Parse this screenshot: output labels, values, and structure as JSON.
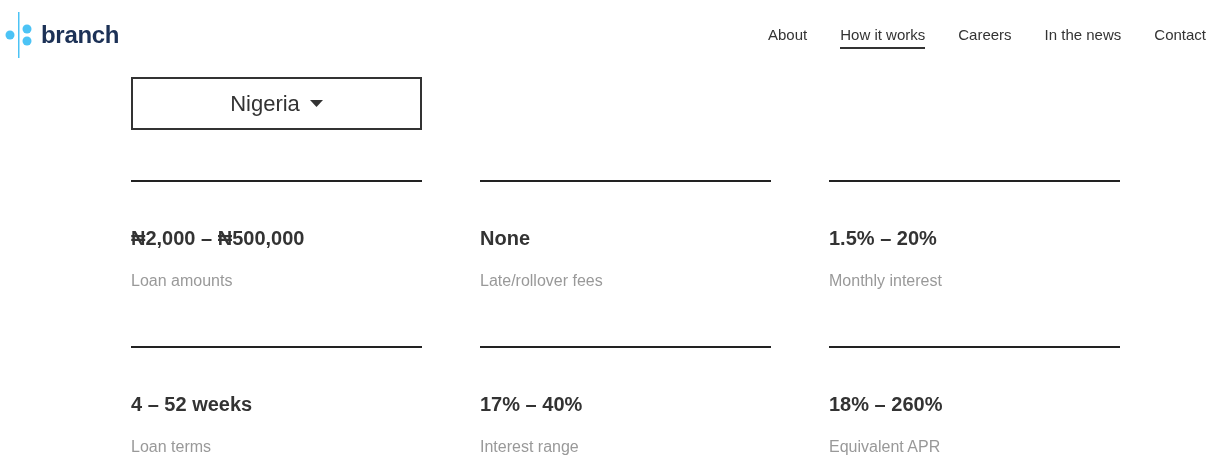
{
  "logo": {
    "text": "branch"
  },
  "nav": [
    {
      "label": "About",
      "selected": false
    },
    {
      "label": "How it works",
      "selected": true
    },
    {
      "label": "Careers",
      "selected": false
    },
    {
      "label": "In the news",
      "selected": false
    },
    {
      "label": "Contact",
      "selected": false
    }
  ],
  "country_select": {
    "value": "Nigeria"
  },
  "stats": [
    {
      "value": "₦2,000 – ₦500,000",
      "label": "Loan amounts"
    },
    {
      "value": "None",
      "label": "Late/rollover fees"
    },
    {
      "value": "1.5% – 20%",
      "label": "Monthly interest"
    },
    {
      "value": "4 – 52 weeks",
      "label": "Loan terms"
    },
    {
      "value": "17% – 40%",
      "label": "Interest range"
    },
    {
      "value": "18% – 260%",
      "label": "Equivalent APR"
    }
  ]
}
